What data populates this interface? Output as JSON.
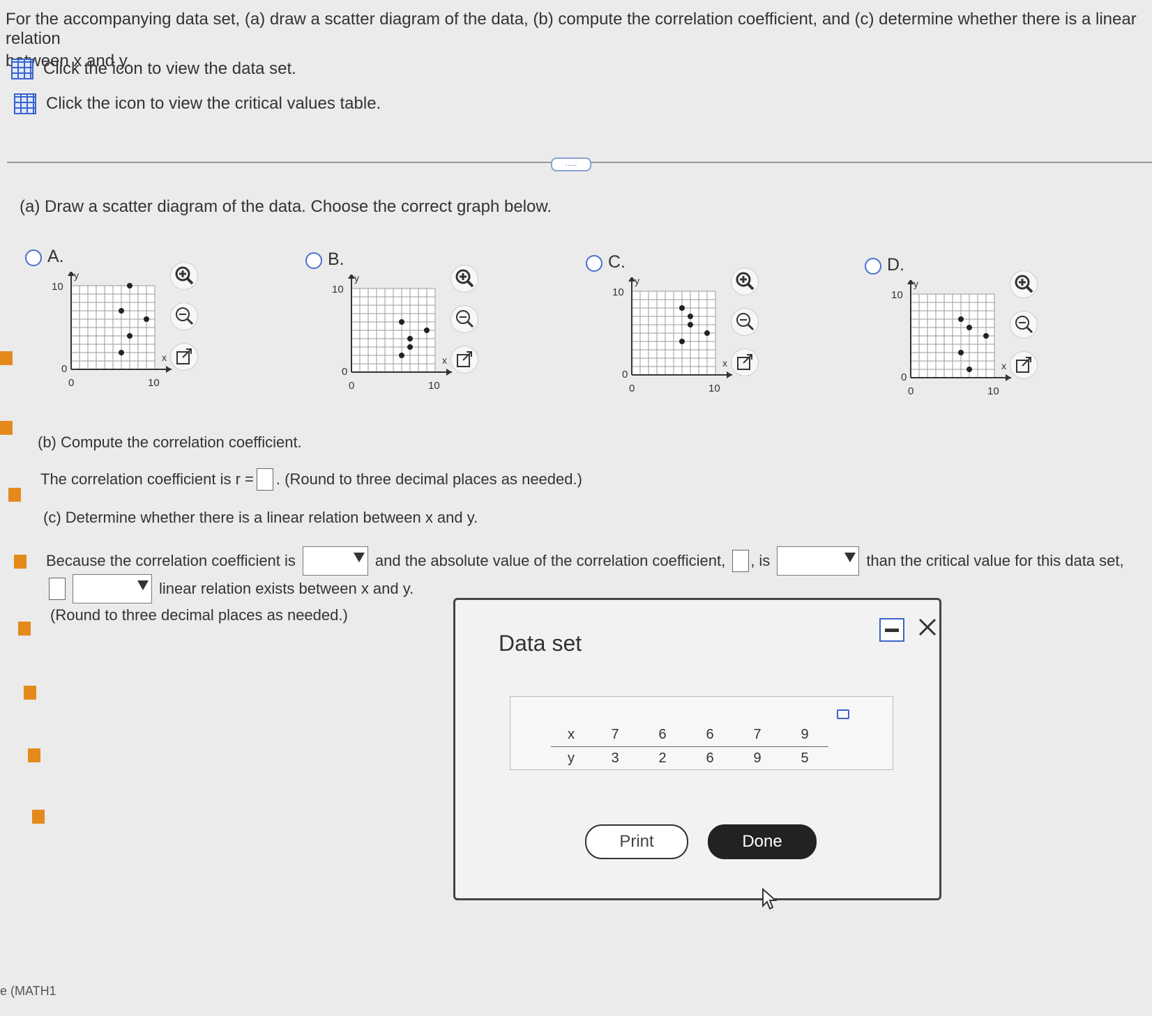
{
  "question": {
    "line1": "For the accompanying data set, (a) draw a scatter diagram of the data, (b) compute the correlation coefficient, and (c) determine whether there is a linear relation",
    "line2": "between x and y.",
    "dataset_link": "Click the icon to view the data set.",
    "critical_link": "Click the icon to view the critical values table.",
    "expand_handle": "....."
  },
  "part_a": {
    "prompt": "(a) Draw a scatter diagram of the data. Choose the correct graph below.",
    "options": [
      {
        "label": "A.",
        "points": [
          [
            7,
            10
          ],
          [
            6,
            7
          ],
          [
            9,
            6
          ],
          [
            7,
            4
          ],
          [
            6,
            2
          ]
        ]
      },
      {
        "label": "B.",
        "points": [
          [
            6,
            6
          ],
          [
            9,
            5
          ],
          [
            7,
            4
          ],
          [
            7,
            3
          ],
          [
            6,
            2
          ]
        ]
      },
      {
        "label": "C.",
        "points": [
          [
            6,
            8
          ],
          [
            7,
            7
          ],
          [
            7,
            6
          ],
          [
            9,
            5
          ],
          [
            6,
            4
          ]
        ]
      },
      {
        "label": "D.",
        "points": [
          [
            6,
            7
          ],
          [
            7,
            6
          ],
          [
            9,
            5
          ],
          [
            6,
            3
          ],
          [
            7,
            1
          ]
        ]
      }
    ],
    "axis": {
      "y_label": "y",
      "x_label": "x",
      "y_top": "10",
      "x_right": "10",
      "origin_y": "0",
      "origin_x": "0",
      "max": 10
    }
  },
  "part_b": {
    "heading": "(b) Compute the correlation coefficient.",
    "prefix": "The correlation coefficient is r =",
    "suffix": ". (Round to three decimal places as needed.)"
  },
  "part_c": {
    "heading": "(c) Determine whether there is a linear relation between x and y.",
    "seg1": "Because the correlation coefficient is",
    "seg2": "and the absolute value of the correlation coefficient,",
    "seg3": ", is",
    "seg4": "than the critical value for this data set,",
    "seg5": "linear relation exists between x and y.",
    "note": "(Round to three decimal places as needed.)"
  },
  "modal": {
    "title": "Data set",
    "table": {
      "x_header": "x",
      "y_header": "y",
      "x": [
        "7",
        "6",
        "6",
        "7",
        "9"
      ],
      "y": [
        "3",
        "2",
        "6",
        "9",
        "5"
      ]
    },
    "print": "Print",
    "done": "Done"
  },
  "footer": {
    "course_tag": "e (MATH1"
  }
}
